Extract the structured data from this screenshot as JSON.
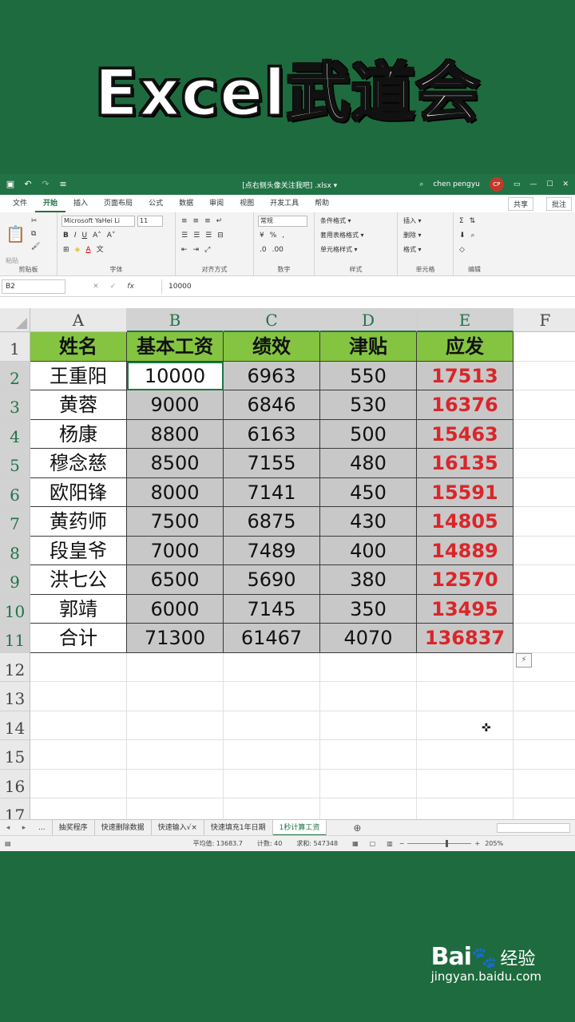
{
  "banner": {
    "title": "Excel武道会"
  },
  "window": {
    "doc_title": "[点右侧头像关注我吧] .xlsx ▾",
    "user": "chen pengyu",
    "avatar_initials": "CP",
    "accent": "#217346"
  },
  "menu": {
    "tabs": [
      "文件",
      "开始",
      "插入",
      "页面布局",
      "公式",
      "数据",
      "审阅",
      "视图",
      "开发工具",
      "帮助"
    ],
    "active": "开始",
    "share": "共享",
    "comment": "批注"
  },
  "ribbon": {
    "clipboard_label": "剪贴板",
    "paste": "粘贴",
    "font_name": "Microsoft YaHei Li",
    "font_size": "11",
    "font_label": "字体",
    "align_label": "对齐方式",
    "number_format": "常规",
    "number_label": "数字",
    "cond_format": "条件格式 ▾",
    "table_format": "套用表格格式 ▾",
    "cell_style": "单元格样式 ▾",
    "styles_label": "样式",
    "insert": "插入 ▾",
    "delete": "删除 ▾",
    "format": "格式 ▾",
    "cells_label": "单元格",
    "editing_label": "编辑"
  },
  "formula_bar": {
    "name_box": "B2",
    "value": "10000",
    "fx": "fx"
  },
  "grid": {
    "columns": [
      "A",
      "B",
      "C",
      "D",
      "E",
      "F"
    ],
    "row_numbers": [
      "1",
      "2",
      "3",
      "4",
      "5",
      "6",
      "7",
      "8",
      "9",
      "10",
      "11",
      "12",
      "13",
      "14",
      "15",
      "16",
      "17"
    ],
    "header": [
      "姓名",
      "基本工资",
      "绩效",
      "津贴",
      "应发"
    ],
    "rows": [
      [
        "王重阳",
        "10000",
        "6963",
        "550",
        "17513"
      ],
      [
        "黄蓉",
        "9000",
        "6846",
        "530",
        "16376"
      ],
      [
        "杨康",
        "8800",
        "6163",
        "500",
        "15463"
      ],
      [
        "穆念慈",
        "8500",
        "7155",
        "480",
        "16135"
      ],
      [
        "欧阳锋",
        "8000",
        "7141",
        "450",
        "15591"
      ],
      [
        "黄药师",
        "7500",
        "6875",
        "430",
        "14805"
      ],
      [
        "段皇爷",
        "7000",
        "7489",
        "400",
        "14889"
      ],
      [
        "洪七公",
        "6500",
        "5690",
        "380",
        "12570"
      ],
      [
        "郭靖",
        "6000",
        "7145",
        "350",
        "13495"
      ],
      [
        "合计",
        "71300",
        "61467",
        "4070",
        "136837"
      ]
    ],
    "header_color": "#84c441",
    "total_color": "#d9262a"
  },
  "sheets": {
    "ellipsis": "...",
    "tabs": [
      "抽奖程序",
      "快速删除数据",
      "快速输入√×",
      "快速填充1年日期",
      "1秒计算工资"
    ],
    "active": "1秒计算工资"
  },
  "status": {
    "average": "平均值: 13683.7",
    "count": "计数: 40",
    "sum": "求和: 547348",
    "zoom": "205%"
  },
  "watermark": {
    "logo": "Bai",
    "logo2": "经验",
    "url": "jingyan.baidu.com"
  }
}
